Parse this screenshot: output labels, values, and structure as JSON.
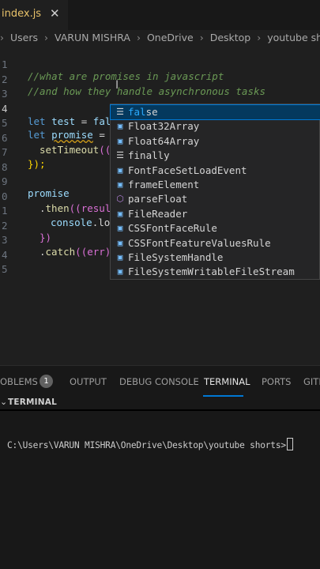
{
  "tab": {
    "filename": "index.js",
    "close": "✕"
  },
  "breadcrumb": [
    "Users",
    "VARUN MISHRA",
    "OneDrive",
    "Desktop",
    "youtube shorts"
  ],
  "gutter": [
    "1",
    "2",
    "3",
    "4",
    "5",
    "6",
    "7",
    "8",
    "9",
    "0",
    "1",
    "2",
    "3",
    "4",
    "5"
  ],
  "code": {
    "l1": "//what are promises in javascript",
    "l2": "//and how they handle asynchronous tasks",
    "l4_kw": "let",
    "l4_var": "test",
    "l4_eq": " = ",
    "l4_typed": "fal",
    "l5_kw": "let",
    "l5_var": "promise",
    "l5_eq": " = (",
    "l6_fn": "setTimeout",
    "l6_rest": "((",
    "l7": "});",
    "l9": "promise",
    "l10_dot": ".",
    "l10_fn": "then",
    "l10_rest": "((resul",
    "l11_var": "console",
    "l11_rest": ".lo",
    "l12": "})",
    "l13_dot": ".",
    "l13_fn": "catch",
    "l13_rest": "((err)"
  },
  "suggestions": [
    {
      "label": "false",
      "match": "fal",
      "icon": "keyword-icon",
      "selected": true
    },
    {
      "label": "Float32Array",
      "icon": "variable-icon"
    },
    {
      "label": "Float64Array",
      "icon": "variable-icon"
    },
    {
      "label": "finally",
      "icon": "keyword-icon"
    },
    {
      "label": "FontFaceSetLoadEvent",
      "icon": "variable-icon"
    },
    {
      "label": "frameElement",
      "icon": "variable-icon"
    },
    {
      "label": "parseFloat",
      "icon": "method-icon"
    },
    {
      "label": "FileReader",
      "icon": "variable-icon"
    },
    {
      "label": "CSSFontFaceRule",
      "icon": "variable-icon"
    },
    {
      "label": "CSSFontFeatureValuesRule",
      "icon": "variable-icon"
    },
    {
      "label": "FileSystemHandle",
      "icon": "variable-icon"
    },
    {
      "label": "FileSystemWritableFileStream",
      "icon": "variable-icon"
    }
  ],
  "panel": {
    "problems": "OBLEMS",
    "problems_count": "1",
    "output": "OUTPUT",
    "debug": "DEBUG CONSOLE",
    "terminal": "TERMINAL",
    "ports": "PORTS",
    "gitlens": "GITL"
  },
  "terminal": {
    "section": "TERMINAL",
    "prompt": "C:\\Users\\VARUN MISHRA\\OneDrive\\Desktop\\youtube shorts>"
  },
  "colors": {
    "accent": "#0078d4",
    "selection": "#04395e",
    "match": "#2aaaff"
  }
}
